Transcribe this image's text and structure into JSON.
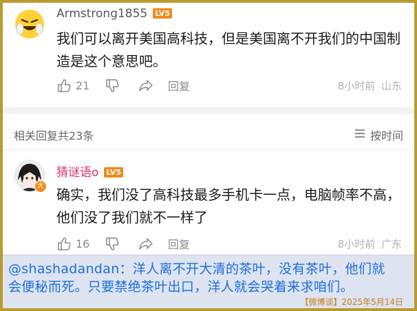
{
  "comment1": {
    "username": "Armstrong1855",
    "level": "LV5",
    "text": "我们可以离开美国高科技，但是美国离不开我们的中国制造是这个意思吧。",
    "likes": "21",
    "reply_label": "回复",
    "time": "8小时前",
    "location": "山东"
  },
  "replies_header": {
    "title": "相关回复共23条",
    "sort_label": "按时间"
  },
  "comment2": {
    "username": "猜谜语o",
    "level": "LV5",
    "text": "确实，我们没了高科技最多手机卡一点，电脑帧率不高，他们没了我们就不一样了",
    "likes": "16",
    "reply_label": "回复",
    "time": "8小时前",
    "location": "广东",
    "badge": "大"
  },
  "caption": {
    "line1": "@shashadandan：洋人离不开大清的茶叶，没有茶叶，他们就",
    "line2": "会便秘而死。只要禁绝茶叶出口，洋人就会哭着来求咱们。",
    "source": "【微博谈】2025年5月14日"
  },
  "colors": {
    "frame": "#b89a2e",
    "username1": "#555555",
    "username2": "#e0326e",
    "caption_text": "#1e6fd8",
    "caption_bg": "#dde3ef",
    "level_badge": "#f08a1a"
  },
  "icons": [
    "emoji-avatar",
    "thumbs-up-icon",
    "thumbs-down-icon",
    "share-icon",
    "sort-icon",
    "anime-avatar"
  ]
}
